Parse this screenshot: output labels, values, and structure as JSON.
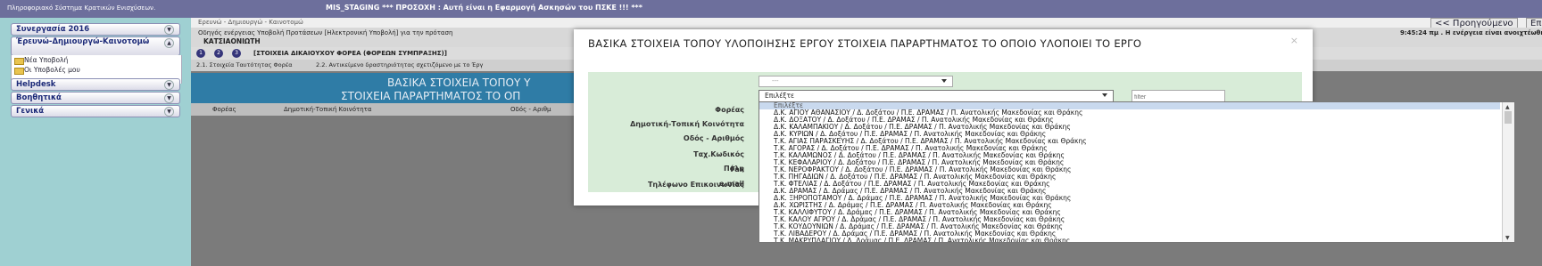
{
  "topbar": {
    "system_name": "Πληροφοριακό Σύστημα Κρατικών Ενισχύσεων.",
    "warning": "MIS_STAGING *** ΠΡΟΣΟΧΗ : Αυτή είναι η Εφαρμογή Ασκησών του ΠΣΚΕ !!! ***"
  },
  "sidebar": {
    "sections": [
      {
        "label": "Συνεργασία 2016"
      },
      {
        "label": "Έρευνώ-Δημιουργώ-Καινοτομώ",
        "items": [
          "Νέα Υποβολή",
          "Οι Υποβολές μου"
        ]
      },
      {
        "label": "Helpdesk"
      },
      {
        "label": "Βοηθητικά"
      },
      {
        "label": "Γενικά"
      }
    ]
  },
  "breadcrumb": "Ερευνώ - Δημιουργώ - Καινοτομώ",
  "nav": {
    "prev_label": "<< Προηγούμενο",
    "next_label": "Επ"
  },
  "infoline": {
    "text": "Οδηγός ενέργειας Υποβολή Προτάσεων [Ηλεκτρονική Υποβολή] για την πρόταση",
    "company": "ΚΑΤΣΙΑΟΝΙΩΤΗ",
    "time": "9:45:24 πμ . Η ενέργεια είναι ανοιχτέωθηση στη"
  },
  "stepbar": {
    "steps": [
      "1",
      "2",
      "3"
    ],
    "label": "[ΣΤΟΙΧΕΙΑ ΔΙΚΑΙΟΥΧΟΥ ΦΟΡΕΑ (ΦΟΡΕΩΝ ΣΥΜΠΡΑΞΗΣ)]"
  },
  "tabs": [
    "2.1. Στοιχεία Ταυτότητας Φορέα",
    "2.2. Αντικείμενο δραστηριότητας σχετιζόμενο με το Έργ"
  ],
  "background_panel": {
    "line1": "ΒΑΣΙΚΑ ΣΤΟΙΧΕΙΑ ΤΟΠΟΥ Υ",
    "line2": "ΣΤΟΙΧΕΙΑ ΠΑΡΑΡΤΗΜΑΤΟΣ ΤΟ ΟΠ",
    "columns": [
      "Φορέας",
      "Δημοτική-Τοπική Κοινότητα",
      "Οδός - Αριθμ"
    ]
  },
  "modal": {
    "title": "ΒΑΣΙΚΑ ΣΤΟΙΧΕΙΑ ΤΟΠΟΥ ΥΛΟΠΟΙΗΣΗΣ ΕΡΓΟΥ ΣΤΟΙΧΕΙΑ ΠΑΡΑΡΤΗΜΑΤΟΣ ΤΟ ΟΠΟΙΟ ΥΛΟΠΟΙΕΙ ΤΟ ΕΡΓΟ",
    "close": "×",
    "fields": {
      "foreas": {
        "label": "Φορέας",
        "value": "---"
      },
      "dimotiki": {
        "label": "Δημοτική-Τοπική Κοινότητα",
        "value": "Επιλέξτε"
      },
      "odos": {
        "label": "Οδός - Αριθμός"
      },
      "tk": {
        "label": "Ταχ.Κωδικός"
      },
      "poli": {
        "label": "Πόλη"
      },
      "tilefono": {
        "label": "Τηλέφωνο Επικοινωνίας"
      },
      "fax": {
        "label": "Fax"
      },
      "email": {
        "label": "e-mail"
      }
    },
    "filter_placeholder": "filter"
  },
  "dropdown": {
    "options": [
      "Επιλέξτε",
      "Δ.Κ. ΑΓΙΟΥ ΑΘΑΝΑΣΙΟΥ / Δ. Δοξάτου / Π.Ε. ΔΡΑΜΑΣ / Π. Ανατολικής Μακεδονίας και Θράκης",
      "Δ.Κ. ΔΟΞΑΤΟΥ / Δ. Δοξάτου / Π.Ε. ΔΡΑΜΑΣ / Π. Ανατολικής Μακεδονίας και Θράκης",
      "Δ.Κ. ΚΑΛΑΜΠΑΚΙΟΥ / Δ. Δοξάτου / Π.Ε. ΔΡΑΜΑΣ / Π. Ανατολικής Μακεδονίας και Θράκης",
      "Δ.Κ. ΚΥΡΙΩΝ / Δ. Δοξάτου / Π.Ε. ΔΡΑΜΑΣ / Π. Ανατολικής Μακεδονίας και Θράκης",
      "Τ.Κ. ΑΓΙΑΣ ΠΑΡΑΣΚΕΥΗΣ / Δ. Δοξάτου / Π.Ε. ΔΡΑΜΑΣ / Π. Ανατολικής Μακεδονίας και Θράκης",
      "Τ.Κ. ΑΓΟΡΑΣ / Δ. Δοξάτου / Π.Ε. ΔΡΑΜΑΣ / Π. Ανατολικής Μακεδονίας και Θράκης",
      "Τ.Κ. ΚΑΛΑΜΩΝΟΣ / Δ. Δοξάτου / Π.Ε. ΔΡΑΜΑΣ / Π. Ανατολικής Μακεδονίας και Θράκης",
      "Τ.Κ. ΚΕΦΑΛΑΡΙΟΥ / Δ. Δοξάτου / Π.Ε. ΔΡΑΜΑΣ / Π. Ανατολικής Μακεδονίας και Θράκης",
      "Τ.Κ. ΝΕΡΟΦΡΑΚΤΟΥ / Δ. Δοξάτου / Π.Ε. ΔΡΑΜΑΣ / Π. Ανατολικής Μακεδονίας και Θράκης",
      "Τ.Κ. ΠΗΓΑΔΙΩΝ / Δ. Δοξάτου / Π.Ε. ΔΡΑΜΑΣ / Π. Ανατολικής Μακεδονίας και Θράκης",
      "Τ.Κ. ΦΤΕΛΙΑΣ / Δ. Δοξάτου / Π.Ε. ΔΡΑΜΑΣ / Π. Ανατολικής Μακεδονίας και Θράκης",
      "Δ.Κ. ΔΡΑΜΑΣ / Δ. Δράμας / Π.Ε. ΔΡΑΜΑΣ / Π. Ανατολικής Μακεδονίας και Θράκης",
      "Δ.Κ. ΞΗΡΟΠΟΤΑΜΟΥ / Δ. Δράμας / Π.Ε. ΔΡΑΜΑΣ / Π. Ανατολικής Μακεδονίας και Θράκης",
      "Δ.Κ. ΧΩΡΙΣΤΗΣ / Δ. Δράμας / Π.Ε. ΔΡΑΜΑΣ / Π. Ανατολικής Μακεδονίας και Θράκης",
      "Τ.Κ. ΚΑΛΛΙΦΥΤΟΥ / Δ. Δράμας / Π.Ε. ΔΡΑΜΑΣ / Π. Ανατολικής Μακεδονίας και Θράκης",
      "Τ.Κ. ΚΑΛΟΥ ΑΓΡΟΥ / Δ. Δράμας / Π.Ε. ΔΡΑΜΑΣ / Π. Ανατολικής Μακεδονίας και Θράκης",
      "Τ.Κ. ΚΟΥΔΟΥΝΙΩΝ / Δ. Δράμας / Π.Ε. ΔΡΑΜΑΣ / Π. Ανατολικής Μακεδονίας και Θράκης",
      "Τ.Κ. ΛΙΒΑΔΕΡΟΥ / Δ. Δράμας / Π.Ε. ΔΡΑΜΑΣ / Π. Ανατολικής Μακεδονίας και Θράκης",
      "Τ.Κ. ΜΑΚΡΥΠΛΑΓΙΟΥ / Δ. Δράμας / Π.Ε. ΔΡΑΜΑΣ / Π. Ανατολικής Μακεδονίας και Θράκης"
    ]
  },
  "colors": {
    "topbar": "#6d6f9c",
    "sidebar_bg": "#9fd0d2",
    "modal_body": "#d8ecd8",
    "panel_blue": "#2f7ca6",
    "selected_option": "#c9d9ee"
  },
  "icons": [
    "folder-icon",
    "chevron-down-icon",
    "chevron-up-icon",
    "close-icon",
    "dropdown-caret-icon"
  ]
}
